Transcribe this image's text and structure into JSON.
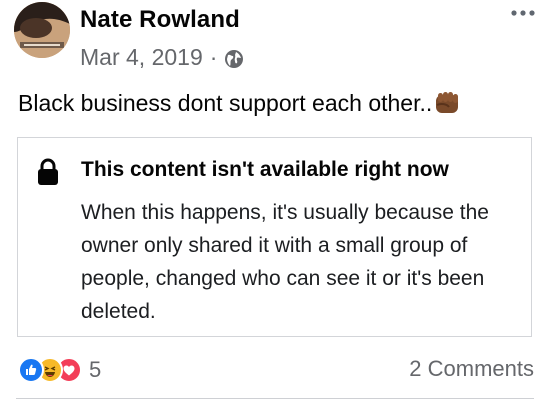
{
  "post": {
    "author": "Nate Rowland",
    "date": "Mar 4, 2019",
    "separator": "·",
    "privacy_icon": "globe-icon",
    "text": "Black business dont support each other..",
    "emoji_icon": "raised-fist-icon"
  },
  "unavailable": {
    "icon": "lock-icon",
    "title": "This content isn't available right now",
    "body": "When this happens, it's usually because the owner only shared it with a small group of people, changed who can see it or it's been deleted."
  },
  "footer": {
    "reaction_icons": [
      "like-icon",
      "haha-icon",
      "love-icon"
    ],
    "reaction_count": "5",
    "comments": "2 Comments"
  },
  "colors": {
    "text": "#050505",
    "secondary": "#65676b",
    "like": "#1877f2",
    "haha": "#f7b928",
    "love": "#f33e58",
    "border": "#d3d5d9"
  }
}
